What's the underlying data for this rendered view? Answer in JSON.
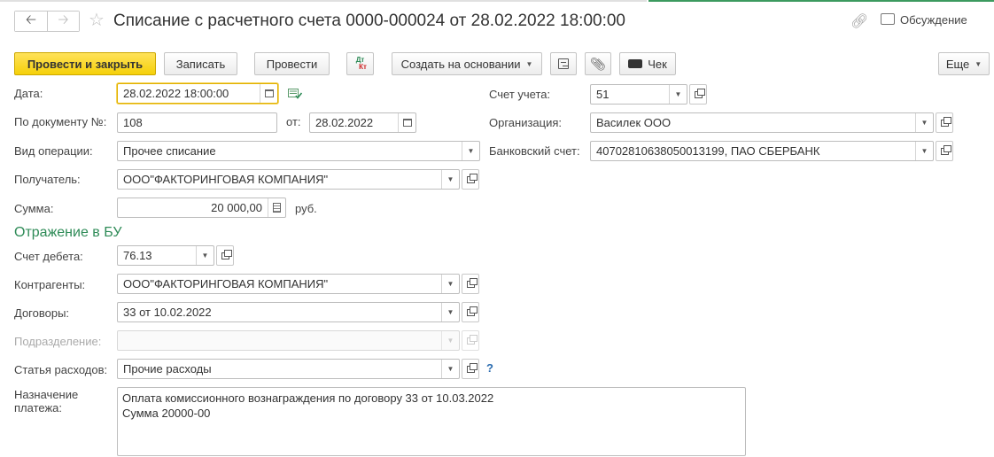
{
  "title": {
    "document_title": "Списание с расчетного счета 0000-000024 от 28.02.2022 18:00:00",
    "discussion": "Обсуждение",
    "back_icon": "arrow-left",
    "forward_icon": "arrow-right",
    "favorite_icon": "star",
    "link_icon": "link"
  },
  "toolbar": {
    "post_close": "Провести и закрыть",
    "save": "Записать",
    "post": "Провести",
    "dt": "Дт",
    "kt": "Кт",
    "create_based_on": "Создать на основании",
    "check": "Чек",
    "more": "Еще"
  },
  "form": {
    "date": {
      "label": "Дата:",
      "value": "28.02.2022 18:00:00"
    },
    "doc_number": {
      "label": "По документу №:",
      "value": "108"
    },
    "doc_date": {
      "label": "от:",
      "value": "28.02.2022"
    },
    "operation_type": {
      "label": "Вид операции:",
      "value": "Прочее списание"
    },
    "recipient": {
      "label": "Получатель:",
      "value": "ООО\"ФАКТОРИНГОВАЯ КОМПАНИЯ\""
    },
    "amount": {
      "label": "Сумма:",
      "value": "20 000,00",
      "currency": "руб."
    },
    "account": {
      "label": "Счет учета:",
      "value": "51"
    },
    "organization": {
      "label": "Организация:",
      "value": "Василек ООО"
    },
    "bank_account": {
      "label": "Банковский счет:",
      "value": "40702810638050013199, ПАО СБЕРБАНК"
    }
  },
  "accounting": {
    "section_title": "Отражение в БУ",
    "debit_account": {
      "label": "Счет дебета:",
      "value": "76.13"
    },
    "counterparties": {
      "label": "Контрагенты:",
      "value": "ООО\"ФАКТОРИНГОВАЯ КОМПАНИЯ\""
    },
    "contracts": {
      "label": "Договоры:",
      "value": "33 от 10.02.2022"
    },
    "department": {
      "label": "Подразделение:",
      "value": ""
    },
    "expense_item": {
      "label": "Статья расходов:",
      "value": "Прочие расходы",
      "help": "?"
    },
    "payment_purpose": {
      "label_line1": "Назначение",
      "label_line2": "платежа:",
      "line1": "Оплата комиссионного вознаграждения по договору 33 от 10.03.2022",
      "line2": "Сумма 20000-00"
    }
  },
  "colors": {
    "primary_button": "#f5d009",
    "section_title": "#2e8b57",
    "help": "#2b6cb0",
    "focus_border": "#e0b000"
  }
}
